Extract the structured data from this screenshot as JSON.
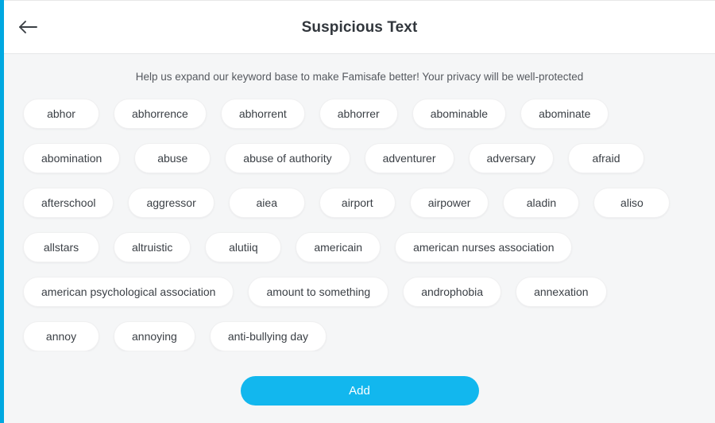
{
  "theme": {
    "accent": "#12b7ee",
    "rail": "#00a8e1",
    "page_bg": "#f5f6f7",
    "header_bg": "#ffffff",
    "pill_bg": "#ffffff",
    "text": "#3a3f45"
  },
  "header": {
    "back_icon": "arrow-left-icon",
    "title": "Suspicious Text"
  },
  "main": {
    "subtitle": "Help us expand our keyword base to make Famisafe better! Your privacy will be well-protected",
    "tags": [
      "abhor",
      "abhorrence",
      "abhorrent",
      "abhorrer",
      "abominable",
      "abominate",
      "abomination",
      "abuse",
      "abuse of authority",
      "adventurer",
      "adversary",
      "afraid",
      "afterschool",
      "aggressor",
      "aiea",
      "airport",
      "airpower",
      "aladin",
      "aliso",
      "allstars",
      "altruistic",
      "alutiiq",
      "americain",
      "american nurses association",
      "american psychological association",
      "amount to something",
      "androphobia",
      "annexation",
      "annoy",
      "annoying",
      "anti-bullying day"
    ]
  },
  "footer": {
    "add_label": "Add"
  }
}
